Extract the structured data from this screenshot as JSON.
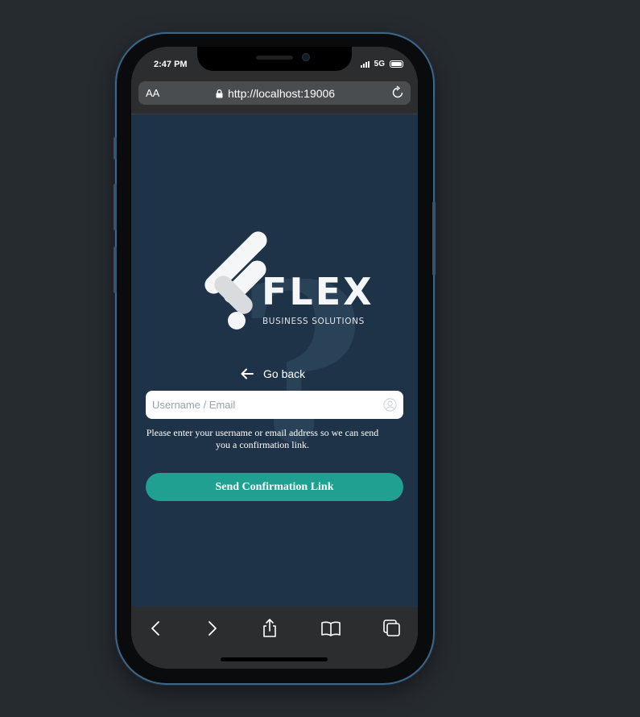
{
  "status_bar": {
    "time": "2:47 PM",
    "network": "5G"
  },
  "browser": {
    "text_size_label": "AA",
    "url": "http://localhost:19006"
  },
  "logo": {
    "brand": "FLEX",
    "tagline": "BUSINESS SOLUTIONS"
  },
  "page": {
    "go_back_label": "Go back",
    "username_placeholder": "Username / Email",
    "help_text": "Please enter your username or email address so we can send you a confirmation link.",
    "submit_label": "Send Confirmation Link"
  },
  "colors": {
    "background": "#1e3348",
    "accent": "#20a090",
    "browser_chrome": "#2b2d2f"
  },
  "toolbar_icons": [
    "back-icon",
    "forward-icon",
    "share-icon",
    "bookmarks-icon",
    "tabs-icon"
  ]
}
